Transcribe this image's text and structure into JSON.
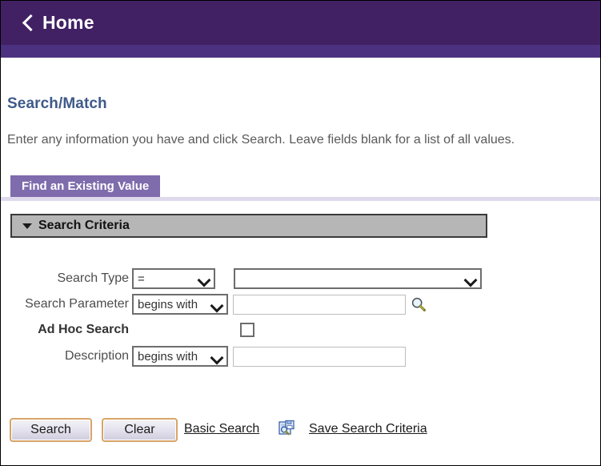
{
  "header": {
    "back_icon": "chevron-left-icon",
    "home_label": "Home",
    "bar_color": "#412164",
    "subbar_color": "#4c3180"
  },
  "page": {
    "title": "Search/Match",
    "title_color": "#3f5a8a",
    "instructions": "Enter any information you have and click Search. Leave fields blank for a list of all values."
  },
  "tabs": [
    {
      "label": "Find an Existing Value",
      "active": true,
      "color": "#7e6cad"
    }
  ],
  "search_criteria": {
    "group_label": "Search Criteria",
    "collapse_icon": "triangle-down-icon",
    "group_color": "#b6b6b6",
    "rows": [
      {
        "label": "Search Type",
        "bold": false,
        "operator": "=",
        "value_dropdown": "",
        "has_lookup": false
      },
      {
        "label": "Search Parameter",
        "bold": false,
        "operator": "begins with",
        "value": "",
        "has_lookup": true,
        "lookup_icon": "magnifier-icon"
      },
      {
        "label": "Ad Hoc Search",
        "bold": true,
        "checkbox_checked": false
      },
      {
        "label": "Description",
        "bold": false,
        "operator": "begins with",
        "value": "",
        "has_lookup": false
      }
    ]
  },
  "footer": {
    "search_button": "Search",
    "clear_button": "Clear",
    "basic_search_link": "Basic Search",
    "save_search_icon": "save-search-icon",
    "save_search_link": "Save Search Criteria"
  }
}
